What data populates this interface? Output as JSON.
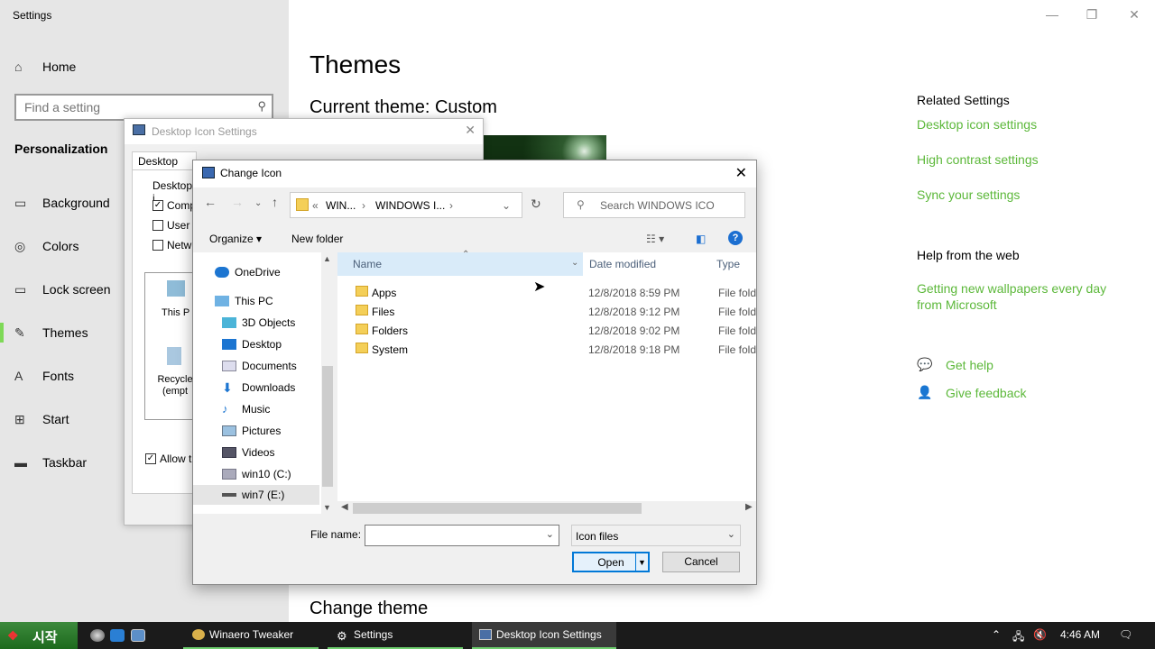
{
  "settings": {
    "window_title": "Settings",
    "home_label": "Home",
    "search_placeholder": "Find a setting",
    "section": "Personalization",
    "nav": [
      "Background",
      "Colors",
      "Lock screen",
      "Themes",
      "Fonts",
      "Start",
      "Taskbar"
    ],
    "active_nav": "Themes",
    "page_title": "Themes",
    "current_theme": "Current theme: Custom",
    "change_theme": "Change theme",
    "related_heading": "Related Settings",
    "related_links": [
      "Desktop icon settings",
      "High contrast settings",
      "Sync your settings"
    ],
    "help_heading": "Help from the web",
    "help_link": "Getting new wallpapers every day from Microsoft",
    "get_help": "Get help",
    "give_feedback": "Give feedback",
    "accent_color": "#5cb83a"
  },
  "desktop_icon_dialog": {
    "title": "Desktop Icon Settings",
    "tab": "Desktop Icons",
    "group": "Desktop i",
    "checkboxes": [
      {
        "label": "Comp",
        "checked": true
      },
      {
        "label": "User",
        "checked": false
      },
      {
        "label": "Netw",
        "checked": false
      }
    ],
    "icons": [
      "This P",
      "Recycle (empt"
    ],
    "allow": "Allow t"
  },
  "change_icon_dialog": {
    "title": "Change Icon",
    "breadcrumb": [
      "«",
      "WIN...",
      "WINDOWS I..."
    ],
    "search_placeholder": "Search WINDOWS ICO",
    "organize": "Organize",
    "new_folder": "New folder",
    "columns": [
      "Name",
      "Date modified",
      "Type"
    ],
    "tree": [
      "OneDrive",
      "This PC",
      "3D Objects",
      "Desktop",
      "Documents",
      "Downloads",
      "Music",
      "Pictures",
      "Videos",
      "win10 (C:)",
      "win7 (E:)"
    ],
    "files": [
      {
        "name": "Apps",
        "date": "12/8/2018 8:59 PM",
        "type": "File folder"
      },
      {
        "name": "Files",
        "date": "12/8/2018 9:12 PM",
        "type": "File folder"
      },
      {
        "name": "Folders",
        "date": "12/8/2018 9:02 PM",
        "type": "File folder"
      },
      {
        "name": "System",
        "date": "12/8/2018 9:18 PM",
        "type": "File folder"
      }
    ],
    "file_name_label": "File name:",
    "file_name_value": "",
    "file_type": "Icon files",
    "open": "Open",
    "cancel": "Cancel"
  },
  "taskbar": {
    "start_label": "시작",
    "tasks": [
      "Winaero Tweaker",
      "Settings",
      "Desktop Icon Settings"
    ],
    "clock": "4:46 AM"
  }
}
